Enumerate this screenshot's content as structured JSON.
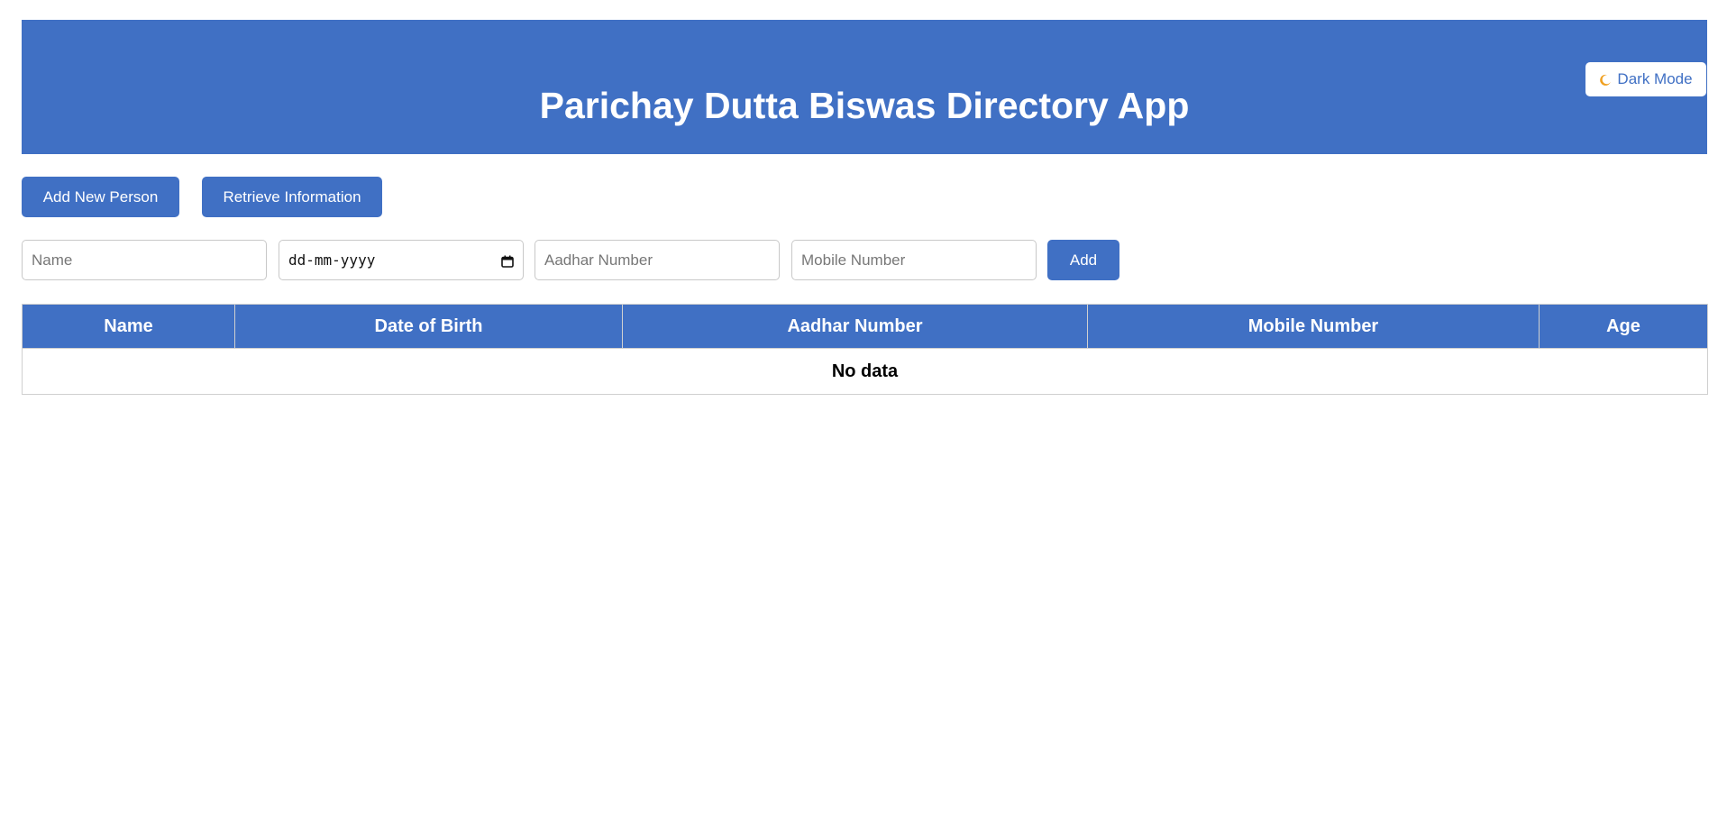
{
  "header": {
    "title": "Parichay Dutta Biswas Directory App",
    "dark_mode_label": "Dark Mode",
    "background": "#4070c4"
  },
  "actions": {
    "add_new_person_label": "Add New Person",
    "retrieve_information_label": "Retrieve Information"
  },
  "form": {
    "name": {
      "placeholder": "Name",
      "value": ""
    },
    "dob": {
      "placeholder": "dd-mm-yyyy",
      "value": ""
    },
    "aadhar": {
      "placeholder": "Aadhar Number",
      "value": ""
    },
    "mobile": {
      "placeholder": "Mobile Number",
      "value": ""
    },
    "add_label": "Add"
  },
  "table": {
    "columns": [
      "Name",
      "Date of Birth",
      "Aadhar Number",
      "Mobile Number",
      "Age"
    ],
    "empty_text": "No data"
  },
  "icons": {
    "dark_mode": "moon-icon",
    "date_picker": "calendar-icon"
  },
  "colors": {
    "accent": "#4070c4",
    "moon": "#f0a020"
  }
}
